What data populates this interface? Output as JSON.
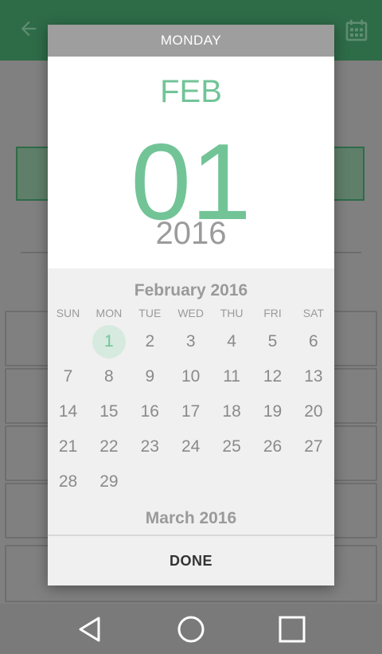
{
  "header": {
    "weekday": "MONDAY"
  },
  "selected_date": {
    "month": "FEB",
    "day": "01",
    "year": "2016"
  },
  "calendar": {
    "title": "February 2016",
    "weekdays": [
      "SUN",
      "MON",
      "TUE",
      "WED",
      "THU",
      "FRI",
      "SAT"
    ],
    "weeks": [
      [
        "",
        "1",
        "2",
        "3",
        "4",
        "5",
        "6"
      ],
      [
        "7",
        "8",
        "9",
        "10",
        "11",
        "12",
        "13"
      ],
      [
        "14",
        "15",
        "16",
        "17",
        "18",
        "19",
        "20"
      ],
      [
        "21",
        "22",
        "23",
        "24",
        "25",
        "26",
        "27"
      ],
      [
        "28",
        "29",
        "",
        "",
        "",
        "",
        ""
      ]
    ],
    "selected_day": "1",
    "next_month_title": "March 2016"
  },
  "footer": {
    "done_label": "DONE"
  },
  "colors": {
    "accent": "#72c497",
    "header_bg": "#9e9e9e",
    "app_bar_dim": "#2e6b47"
  },
  "icons": {
    "back": "arrow-left-icon",
    "calendar": "calendar-icon",
    "nav_back": "triangle-back-icon",
    "nav_home": "circle-home-icon",
    "nav_recents": "square-recents-icon"
  }
}
